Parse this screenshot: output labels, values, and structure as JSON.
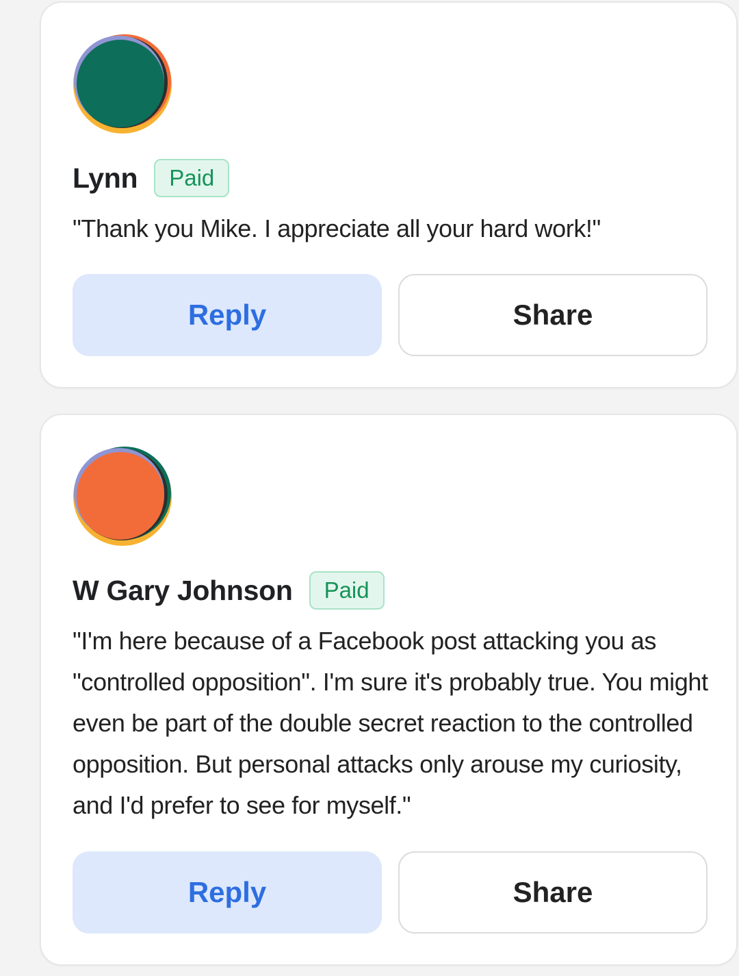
{
  "colors": {
    "page_background": "#f3f3f3",
    "card_background": "#ffffff",
    "reply_button_bg": "#dde8fc",
    "reply_button_text": "#2d6ee0",
    "paid_badge_bg": "#e3f6ed",
    "paid_badge_text": "#16935a"
  },
  "comments": [
    {
      "author": "Lynn",
      "badge": "Paid",
      "avatar_icon": "avatar-green-orb-icon",
      "text": "\"Thank you Mike. I appreciate all your hard work!\"",
      "reply_label": "Reply",
      "share_label": "Share"
    },
    {
      "author": "W Gary Johnson",
      "badge": "Paid",
      "avatar_icon": "avatar-orange-orb-icon",
      "text": "\"I'm here because of a Facebook post attacking you as \"controlled opposition\". I'm sure it's probably true. You might even be part of the double secret reaction to the controlled opposition. But personal attacks only arouse my curiosity, and I'd prefer to see for myself.\"",
      "reply_label": "Reply",
      "share_label": "Share"
    }
  ]
}
